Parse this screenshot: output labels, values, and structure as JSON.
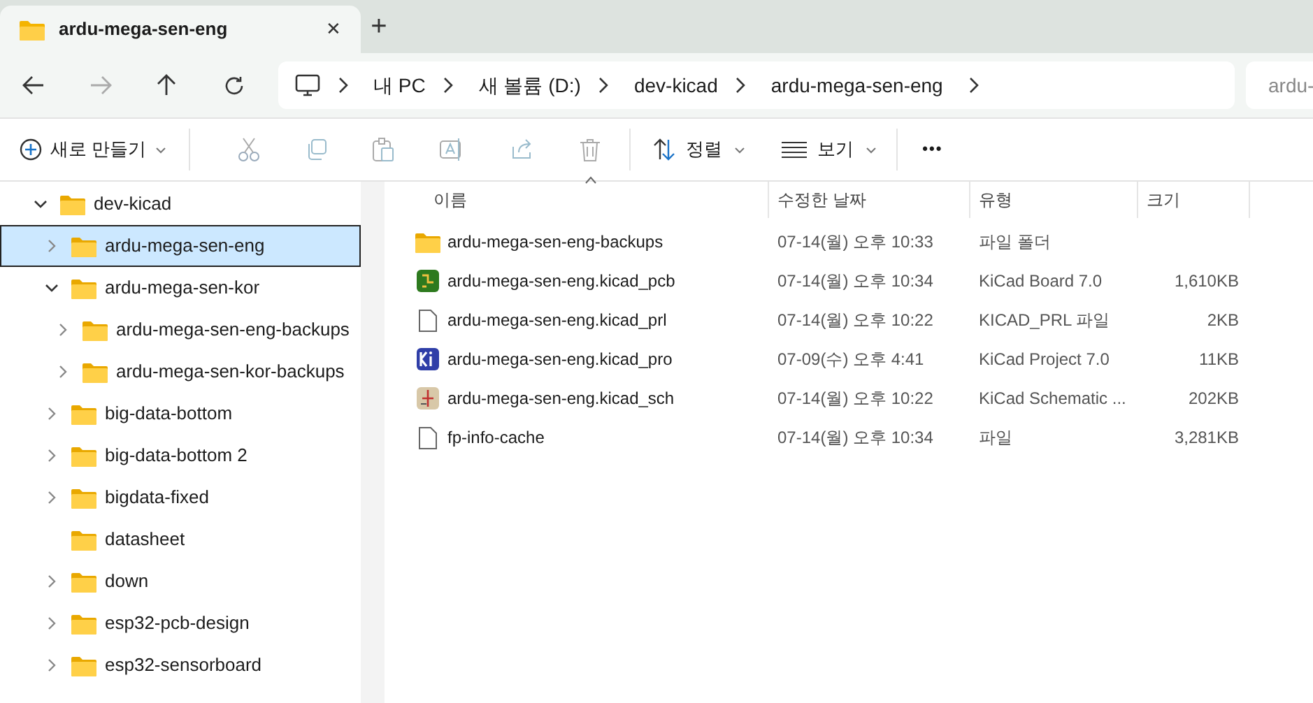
{
  "tab": {
    "title": "ardu-mega-sen-eng",
    "close": "✕",
    "new_tab": "+"
  },
  "address": {
    "crumbs": [
      "내 PC",
      "새 볼륨 (D:)",
      "dev-kicad",
      "ardu-mega-sen-eng"
    ],
    "search_placeholder": "ardu-"
  },
  "toolbar": {
    "new": "새로 만들기",
    "sort": "정렬",
    "view": "보기",
    "more": "•••"
  },
  "tree": [
    {
      "label": "dev-kicad",
      "expandable": true,
      "expanded": true,
      "selected": false,
      "children": [
        {
          "label": "ardu-mega-sen-eng",
          "expandable": true,
          "expanded": false,
          "selected": true
        },
        {
          "label": "ardu-mega-sen-kor",
          "expandable": true,
          "expanded": true,
          "selected": false,
          "children": [
            {
              "label": "ardu-mega-sen-eng-backups",
              "expandable": true,
              "expanded": false,
              "selected": false
            },
            {
              "label": "ardu-mega-sen-kor-backups",
              "expandable": true,
              "expanded": false,
              "selected": false
            }
          ]
        },
        {
          "label": "big-data-bottom",
          "expandable": true,
          "expanded": false,
          "selected": false
        },
        {
          "label": "big-data-bottom 2",
          "expandable": true,
          "expanded": false,
          "selected": false
        },
        {
          "label": "bigdata-fixed",
          "expandable": true,
          "expanded": false,
          "selected": false
        },
        {
          "label": "datasheet",
          "expandable": false,
          "expanded": false,
          "selected": false
        },
        {
          "label": "down",
          "expandable": true,
          "expanded": false,
          "selected": false
        },
        {
          "label": "esp32-pcb-design",
          "expandable": true,
          "expanded": false,
          "selected": false
        },
        {
          "label": "esp32-sensorboard",
          "expandable": true,
          "expanded": false,
          "selected": false
        }
      ]
    }
  ],
  "table": {
    "columns": [
      "이름",
      "수정한 날짜",
      "유형",
      "크기"
    ],
    "rows": [
      {
        "kind": "folder",
        "name": "ardu-mega-sen-eng-backups",
        "date": "07-14(월) 오후 10:33",
        "type": "파일 폴더"
      },
      {
        "kind": "pcb",
        "name": "ardu-mega-sen-eng.kicad_pcb",
        "date": "07-14(월) 오후 10:34",
        "type": "KiCad Board 7.0",
        "size": "1,610KB"
      },
      {
        "kind": "file",
        "name": "ardu-mega-sen-eng.kicad_prl",
        "date": "07-14(월) 오후 10:22",
        "type": "KICAD_PRL 파일",
        "size": "2KB"
      },
      {
        "kind": "project",
        "name": "ardu-mega-sen-eng.kicad_pro",
        "date": "07-09(수) 오후 4:41",
        "type": "KiCad Project 7.0",
        "size": "11KB"
      },
      {
        "kind": "schematic",
        "name": "ardu-mega-sen-eng.kicad_sch",
        "date": "07-14(월) 오후 10:22",
        "type": "KiCad Schematic ...",
        "size": "202KB"
      },
      {
        "kind": "file",
        "name": "fp-info-cache",
        "date": "07-14(월) 오후 10:34",
        "type": "파일",
        "size": "3,281KB"
      }
    ]
  }
}
